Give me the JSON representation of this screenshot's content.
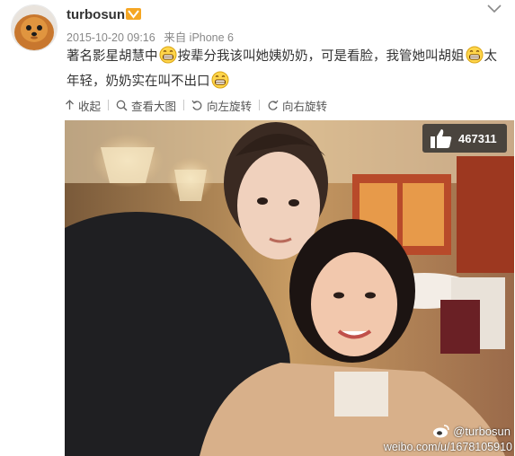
{
  "post": {
    "username": "turbosun",
    "timestamp": "2015-10-20 09:16",
    "source": "来自 iPhone 6",
    "text_segments": [
      "著名影星胡慧中",
      "按辈分我该叫她姨奶奶，可是看脸，我管她叫胡姐",
      "太年轻，奶奶实在叫不出口"
    ]
  },
  "actions": {
    "collapse": "收起",
    "view_large": "查看大图",
    "rotate_left": "向左旋转",
    "rotate_right": "向右旋转"
  },
  "photo": {
    "like_count": "467311",
    "watermark_user": "@turbosun",
    "watermark_url": "weibo.com/u/1678105910"
  },
  "colors": {
    "accent_orange": "#f5a623",
    "meta_gray": "#888888"
  },
  "icons": [
    "verified-vip-icon",
    "chevron-down-icon",
    "grin-emoji-icon",
    "thumbs-up-icon",
    "weibo-logo-icon"
  ]
}
